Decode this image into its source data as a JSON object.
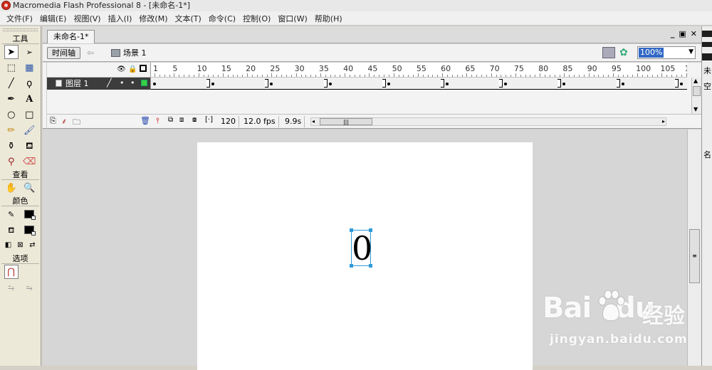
{
  "window": {
    "title": "Macromedia Flash Professional 8 - [未命名-1*]"
  },
  "menu": [
    "文件(F)",
    "编辑(E)",
    "视图(V)",
    "插入(I)",
    "修改(M)",
    "文本(T)",
    "命令(C)",
    "控制(O)",
    "窗口(W)",
    "帮助(H)"
  ],
  "tools_panel": {
    "tools_header": "工具",
    "view_header": "查看",
    "color_header": "颜色",
    "options_header": "选项",
    "stroke_color": "#000000",
    "fill_color": "#000000"
  },
  "document": {
    "tab_label": "未命名-1*",
    "timeline_button": "时间轴",
    "scene_label": "场景 1",
    "zoom_value": "100%",
    "window_controls": [
      "_",
      "▣",
      "✕"
    ]
  },
  "timeline": {
    "ruler_numbers": [
      "1",
      "5",
      "10",
      "15",
      "20",
      "25",
      "30",
      "35",
      "40",
      "45",
      "50",
      "55",
      "60",
      "65",
      "70",
      "75",
      "80",
      "85",
      "90",
      "95",
      "100",
      "105",
      "1"
    ],
    "layer_name": "图层 1",
    "current_frame": "120",
    "frame_rate": "12.0 fps",
    "elapsed_time": "9.9s"
  },
  "stage": {
    "text_content": "0"
  },
  "right_panel": {
    "labels": [
      "未",
      "空",
      "名"
    ]
  },
  "watermark": {
    "brand": "Bai",
    "brand2": "du",
    "chinese": "经验",
    "url": "jingyan.baidu.com"
  }
}
